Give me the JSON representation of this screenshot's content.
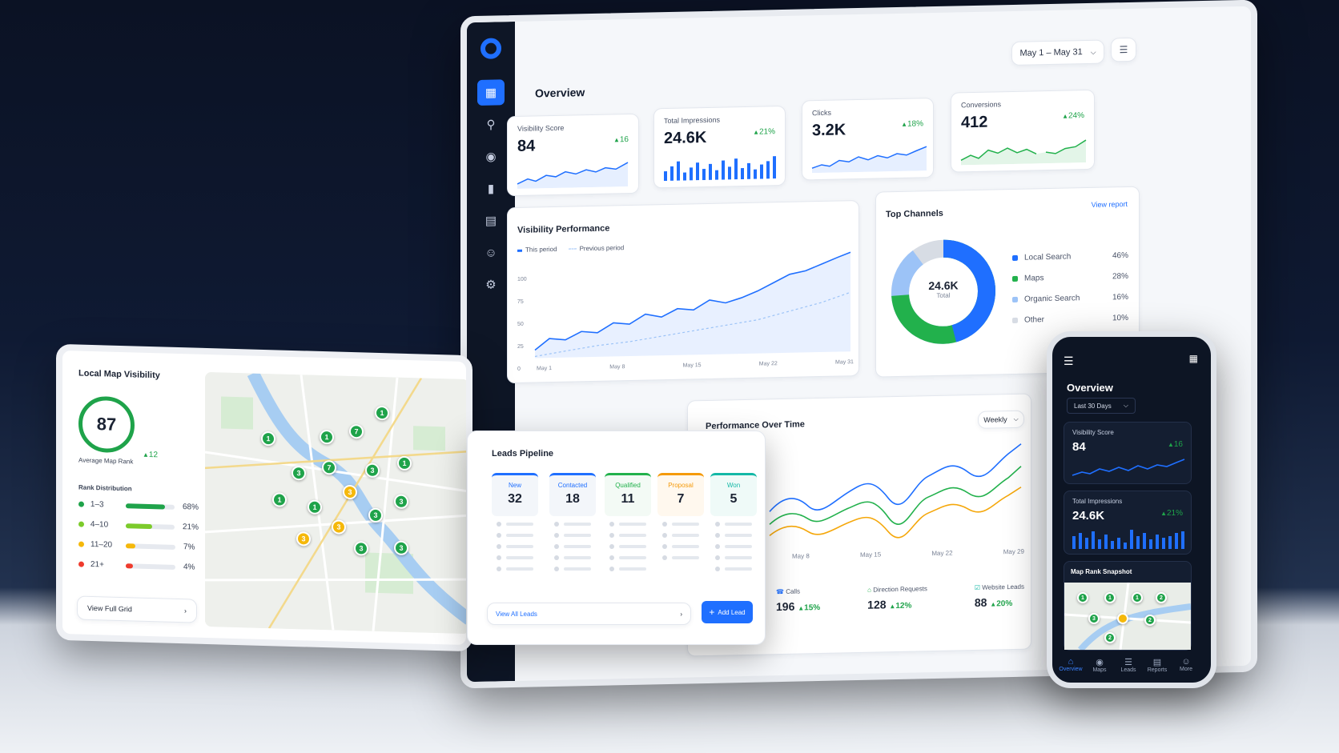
{
  "desktop": {
    "date_range": "May 1 – May 31",
    "page_title": "Overview",
    "kpis": [
      {
        "label": "Visibility Score",
        "value": "84",
        "change": "16"
      },
      {
        "label": "Total Impressions",
        "value": "24.6K",
        "change": "21%"
      },
      {
        "label": "Clicks",
        "value": "3.2K",
        "change": "18%"
      },
      {
        "label": "Conversions",
        "value": "412",
        "change": "24%"
      }
    ],
    "visibility_performance": {
      "title": "Visibility Performance",
      "legend_this": "This period",
      "legend_prev": "Previous period",
      "y_ticks": [
        "100",
        "75",
        "50",
        "25",
        "0"
      ],
      "x_ticks": [
        "May 1",
        "May 8",
        "May 15",
        "May 22",
        "May 31"
      ]
    },
    "top_channels": {
      "title": "Top Channels",
      "link": "View report",
      "center_value": "24.6K",
      "center_label": "Total",
      "items": [
        {
          "name": "Local Search",
          "pct": "46%",
          "color": "#1f6fff"
        },
        {
          "name": "Maps",
          "pct": "28%",
          "color": "#22b14c"
        },
        {
          "name": "Organic Search",
          "pct": "16%",
          "color": "#9cc3f7"
        },
        {
          "name": "Other",
          "pct": "10%",
          "color": "#d7dce4"
        }
      ]
    },
    "performance_over_time": {
      "title": "Performance Over Time",
      "interval": "Weekly",
      "x_ticks": [
        "May 8",
        "May 15",
        "May 22",
        "May 29"
      ],
      "stats": [
        {
          "label": "Calls",
          "value": "196",
          "change": "15%"
        },
        {
          "label": "Direction Requests",
          "value": "128",
          "change": "12%"
        },
        {
          "label": "Website Leads",
          "value": "88",
          "change": "20%"
        }
      ]
    }
  },
  "tablet": {
    "title": "Local Map Visibility",
    "rank_value": "87",
    "rank_label": "Average Map Rank",
    "rank_change": "12",
    "distribution_title": "Rank Distribution",
    "distribution": [
      {
        "range": "1–3",
        "pct": "68%",
        "fraction": 0.8,
        "color": "#1fa34a"
      },
      {
        "range": "4–10",
        "pct": "21%",
        "fraction": 0.55,
        "color": "#7ccb2b"
      },
      {
        "range": "11–20",
        "pct": "7%",
        "fraction": 0.2,
        "color": "#f5b80a"
      },
      {
        "range": "21+",
        "pct": "4%",
        "fraction": 0.14,
        "color": "#ef3b2d"
      }
    ],
    "view_full": "View Full Grid",
    "pins": [
      "1",
      "1",
      "1",
      "1",
      "7",
      "1",
      "3",
      "7",
      "3",
      "1",
      "3",
      "1",
      "3",
      "3",
      "3",
      "3",
      "3",
      "3",
      "3",
      "3"
    ]
  },
  "leads": {
    "title": "Leads Pipeline",
    "stages": [
      {
        "label": "New",
        "count": "32",
        "color": "#1f6fff"
      },
      {
        "label": "Contacted",
        "count": "18",
        "color": "#1f6fff"
      },
      {
        "label": "Qualified",
        "count": "11",
        "color": "#22b14c"
      },
      {
        "label": "Proposal",
        "count": "7",
        "color": "#f59a0a"
      },
      {
        "label": "Won",
        "count": "5",
        "color": "#14b8a6"
      }
    ],
    "view_all": "View All Leads",
    "add_lead": "Add Lead"
  },
  "phone": {
    "title": "Overview",
    "period": "Last 30 Days",
    "cards": [
      {
        "label": "Visibility Score",
        "value": "84",
        "change": "16"
      },
      {
        "label": "Total Impressions",
        "value": "24.6K",
        "change": "21%"
      }
    ],
    "map_title": "Map Rank Snapshot",
    "map_pins": [
      "1",
      "1",
      "1",
      "2",
      "3",
      "2",
      "2"
    ],
    "nav": [
      "Overview",
      "Maps",
      "Leads",
      "Reports",
      "More"
    ]
  }
}
